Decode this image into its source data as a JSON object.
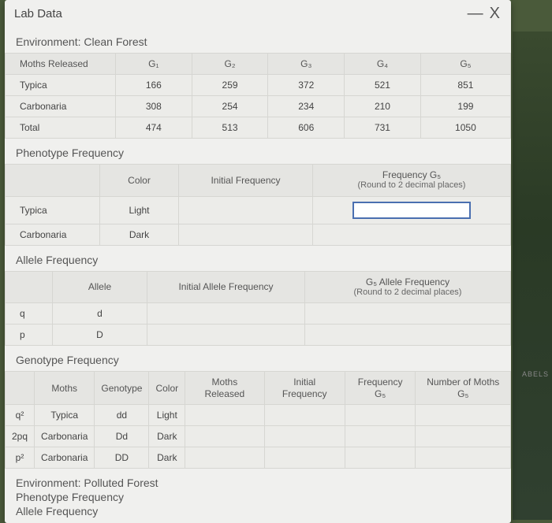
{
  "window": {
    "title": "Lab Data",
    "bg_label": "ABELS"
  },
  "env1": {
    "title": "Environment: Clean Forest",
    "moths_table": {
      "row_header": "Moths Released",
      "cols": [
        "G₁",
        "G₂",
        "G₃",
        "G₄",
        "G₅"
      ],
      "rows": [
        {
          "name": "Typica",
          "vals": [
            "166",
            "259",
            "372",
            "521",
            "851"
          ]
        },
        {
          "name": "Carbonaria",
          "vals": [
            "308",
            "254",
            "234",
            "210",
            "199"
          ]
        },
        {
          "name": "Total",
          "vals": [
            "474",
            "513",
            "606",
            "731",
            "1050"
          ]
        }
      ]
    },
    "pheno": {
      "heading": "Phenotype Frequency",
      "col_color": "Color",
      "col_init": "Initial Frequency",
      "col_g5a": "Frequency G₅",
      "col_g5b": "(Round to 2 decimal places)",
      "rows": [
        {
          "name": "Typica",
          "color": "Light"
        },
        {
          "name": "Carbonaria",
          "color": "Dark"
        }
      ]
    },
    "allele": {
      "heading": "Allele Frequency",
      "col_allele": "Allele",
      "col_init": "Initial Allele Frequency",
      "col_g5a": "G₅ Allele Frequency",
      "col_g5b": "(Round to 2 decimal places)",
      "rows": [
        {
          "name": "q",
          "allele": "d"
        },
        {
          "name": "p",
          "allele": "D"
        }
      ]
    },
    "geno": {
      "heading": "Genotype Frequency",
      "cols": [
        "",
        "Moths",
        "Genotype",
        "Color",
        "Moths Released",
        "Initial Frequency",
        "Frequency G₅",
        "Number of Moths G₅"
      ],
      "rows": [
        {
          "sym": "q²",
          "moth": "Typica",
          "geno": "dd",
          "color": "Light"
        },
        {
          "sym": "2pq",
          "moth": "Carbonaria",
          "geno": "Dd",
          "color": "Dark"
        },
        {
          "sym": "p²",
          "moth": "Carbonaria",
          "geno": "DD",
          "color": "Dark"
        }
      ]
    }
  },
  "env2": {
    "title": "Environment: Polluted Forest",
    "pheno": "Phenotype Frequency",
    "allele": "Allele Frequency"
  },
  "chart_data": {
    "type": "table",
    "title": "Moths Released — Clean Forest",
    "categories": [
      "G1",
      "G2",
      "G3",
      "G4",
      "G5"
    ],
    "series": [
      {
        "name": "Typica",
        "values": [
          166,
          259,
          372,
          521,
          851
        ]
      },
      {
        "name": "Carbonaria",
        "values": [
          308,
          254,
          234,
          210,
          199
        ]
      },
      {
        "name": "Total",
        "values": [
          474,
          513,
          606,
          731,
          1050
        ]
      }
    ]
  }
}
